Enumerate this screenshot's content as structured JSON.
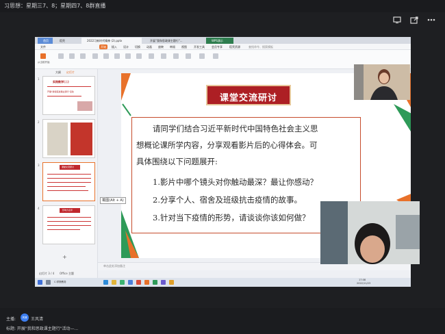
{
  "meeting": {
    "title": "习思想：星期三7、8；星期四7、8群直播",
    "icons": [
      "share-screen-icon",
      "export-icon",
      "more-icon"
    ],
    "host_label": "主播:",
    "host_avatar_text": "风清",
    "host_name": "王风清",
    "topic": "标题: 开展\"我和思政课主题行\"活动—..."
  },
  "wps": {
    "tabs": [
      "首页",
      "稻壳",
      "2022习新时代精神 (2).pptx",
      "开展\"我和思政课主题行\"...",
      "WPS演示"
    ],
    "menu": [
      "文件",
      "开始",
      "插入",
      "设计",
      "切换",
      "动画",
      "放映",
      "审阅",
      "视图",
      "开发工具",
      "会员专享",
      "稻壳资源"
    ],
    "search": "查找命令、搜索模板",
    "ribbon_left": "从当前开始",
    "thumb_tabs": [
      "大纲",
      "幻灯片"
    ],
    "thumbs": [
      {
        "num": "1",
        "title": "实践教学(二)",
        "subtitle": "开展\"我和思政课主题行\"活动"
      },
      {
        "num": "2",
        "title": "",
        "subtitle": ""
      },
      {
        "num": "3",
        "title": "课堂交流研讨",
        "subtitle": ""
      },
      {
        "num": "4",
        "title": "影响力点评",
        "subtitle": ""
      }
    ],
    "status": "幻灯片 3 / 4",
    "theme": "Office 主题",
    "notes_placeholder": "单击此处添加备注",
    "tooltip": "截图(Alt + A)",
    "taskbar_search": "C:学院教务",
    "clock": "17:08",
    "date": "2022/11/23"
  },
  "slide": {
    "title": "课堂交流研讨",
    "lines": [
      "请同学们结合习近平新时代中国特色社会主义思",
      "想概论课所学内容，分享观看影片后的心得体会。可",
      "具体围绕以下问题展开:",
      "1.影片中哪个镜头对你触动最深？最让你感动？",
      "2.分享个人、宿舍及班级抗击疫情的故事。",
      "3.针对当下疫情的形势，请谈谈你该如何做？"
    ]
  },
  "colors": {
    "accent_red": "#ad1f24",
    "accent_green": "#2e9a58",
    "accent_orange": "#e8712a",
    "background": "#1e1f22"
  }
}
